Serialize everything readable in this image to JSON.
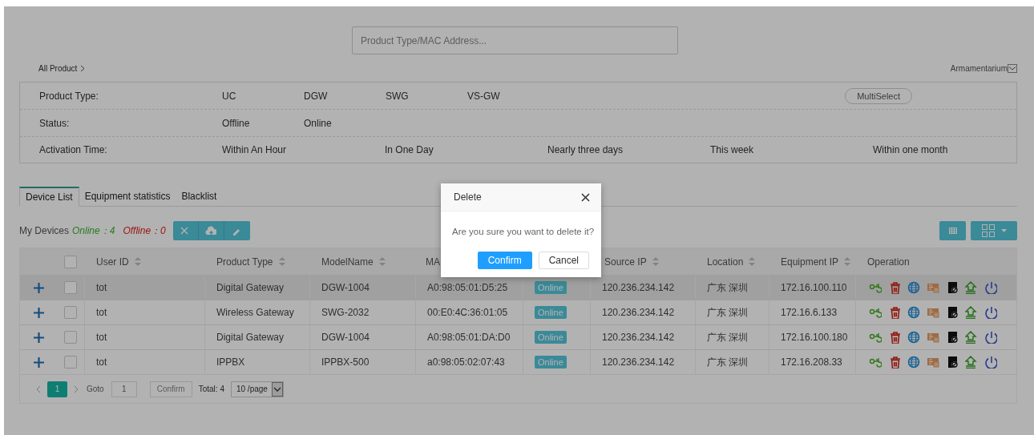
{
  "search": {
    "placeholder": "Product Type/MAC Address..."
  },
  "breadcrumb": {
    "label": "All Product"
  },
  "view_selector": {
    "value": "Armamentarium"
  },
  "filters": [
    {
      "label": "Product Type:",
      "kind": "narrow",
      "options": [
        "UC",
        "DGW",
        "SWG",
        "VS-GW"
      ],
      "action": "MultiSelect"
    },
    {
      "label": "Status:",
      "kind": "narrow",
      "options": [
        "Offline",
        "Online"
      ]
    },
    {
      "label": "Activation Time:",
      "kind": "wide",
      "options": [
        "Within An Hour",
        "In One Day",
        "Nearly three days",
        "This week",
        "Within one month"
      ]
    }
  ],
  "tabs": [
    {
      "label": "Device List",
      "selected": true
    },
    {
      "label": "Equipment statistics",
      "selected": false
    },
    {
      "label": "Blacklist",
      "selected": false
    }
  ],
  "summary": {
    "label": "My Devices",
    "online": "Online：4",
    "offline": "Offline：0"
  },
  "table": {
    "header_checked": false,
    "columns": [
      {
        "kind": "text",
        "label": "User ID",
        "sortable": true
      },
      {
        "kind": "text",
        "label": "Product Type",
        "sortable": true
      },
      {
        "kind": "text",
        "label": "ModelName",
        "sortable": true
      },
      {
        "kind": "text",
        "label": "MA"
      },
      {
        "kind": "status"
      },
      {
        "kind": "text",
        "label": "Source IP",
        "sortable": true
      },
      {
        "kind": "text",
        "label": "Location",
        "sortable": true
      },
      {
        "kind": "text",
        "label": "Equipment IP",
        "sortable": true
      },
      {
        "kind": "actions",
        "label": "Operation"
      }
    ],
    "rows": [
      {
        "hovered": true,
        "checked": false,
        "cells": [
          "tot",
          "Digital Gateway",
          "DGW-1004",
          "A0:98:05:01:D5:25",
          "Online",
          "120.236.234.142",
          "广东 深圳",
          "172.16.100.110"
        ]
      },
      {
        "hovered": false,
        "checked": false,
        "cells": [
          "tot",
          "Wireless Gateway",
          "SWG-2032",
          "00:E0:4C:36:01:05",
          "Online",
          "120.236.234.142",
          "广东 深圳",
          "172.16.6.133"
        ]
      },
      {
        "hovered": false,
        "checked": false,
        "cells": [
          "tot",
          "Digital Gateway",
          "DGW-1004",
          "A0:98:05:01:DA:D0",
          "Online",
          "120.236.234.142",
          "广东 深圳",
          "172.16.100.180"
        ]
      },
      {
        "hovered": false,
        "checked": false,
        "cells": [
          "tot",
          "IPPBX",
          "IPPBX-500",
          "a0:98:05:02:07:43",
          "Online",
          "120.236.234.142",
          "广东 深圳",
          "172.16.208.33"
        ]
      }
    ]
  },
  "pagination": {
    "pages": [
      {
        "label": "1",
        "selected": true
      }
    ],
    "goto_label": "Goto",
    "goto_value": "1",
    "confirm": "Confirm",
    "total": "Total: 4",
    "page_size": "10 /page"
  },
  "dialog": {
    "title": "Delete",
    "message": "Are you sure you want to delete it?",
    "buttons": [
      {
        "label": "Confirm",
        "kind": "primary"
      },
      {
        "label": "Cancel",
        "kind": "default"
      }
    ]
  }
}
